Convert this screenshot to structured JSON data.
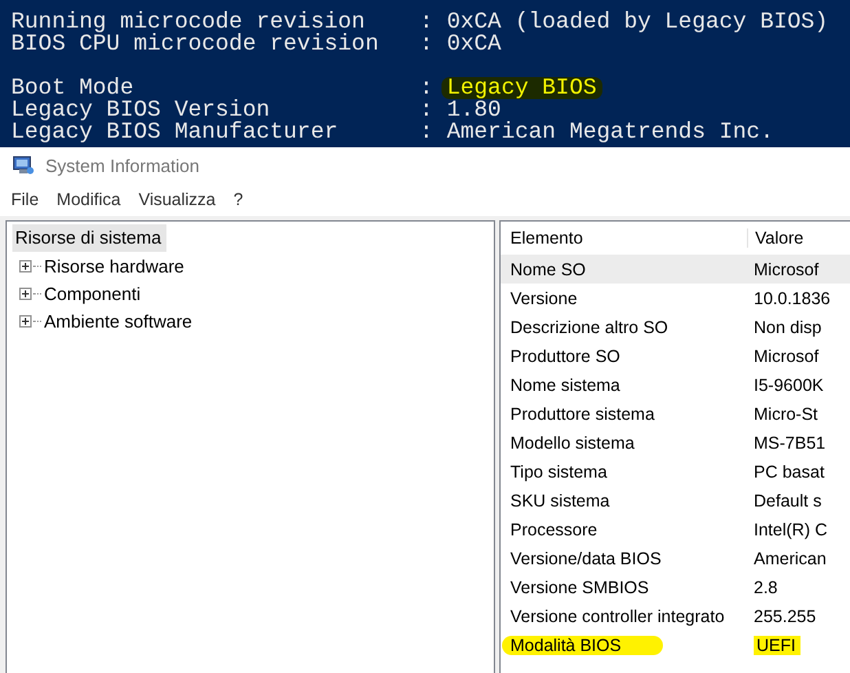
{
  "terminal": {
    "groups": [
      [
        {
          "label": "Running microcode revision",
          "separator": ":",
          "value": "0xCA (loaded by Legacy BIOS)",
          "highlighted": false
        },
        {
          "label": "BIOS CPU microcode revision",
          "separator": ":",
          "value": "0xCA",
          "highlighted": false
        }
      ],
      [
        {
          "label": "Boot Mode",
          "separator": ":",
          "value": "Legacy BIOS",
          "highlighted": true
        },
        {
          "label": "Legacy BIOS Version",
          "separator": ":",
          "value": "1.80",
          "highlighted": false
        },
        {
          "label": "Legacy BIOS Manufacturer",
          "separator": ":",
          "value": "American Megatrends Inc.",
          "highlighted": false
        }
      ]
    ]
  },
  "window": {
    "title": "System Information"
  },
  "menu": [
    "File",
    "Modifica",
    "Visualizza",
    "?"
  ],
  "tree": {
    "label": "Risorse di sistema",
    "selected": true,
    "children": [
      {
        "label": "Risorse hardware",
        "expanded": false,
        "selected": false
      },
      {
        "label": "Componenti",
        "expanded": false,
        "selected": false
      },
      {
        "label": "Ambiente software",
        "expanded": false,
        "selected": false
      }
    ]
  },
  "table": {
    "columns": [
      "Elemento",
      "Valore"
    ],
    "rows": [
      {
        "item": "Nome SO",
        "value": "Microsof",
        "selected": true,
        "highlighted": false
      },
      {
        "item": "Versione",
        "value": "10.0.1836",
        "selected": false,
        "highlighted": false
      },
      {
        "item": "Descrizione altro SO",
        "value": "Non disp",
        "selected": false,
        "highlighted": false
      },
      {
        "item": "Produttore SO",
        "value": "Microsof",
        "selected": false,
        "highlighted": false
      },
      {
        "item": "Nome sistema",
        "value": "I5-9600K",
        "selected": false,
        "highlighted": false
      },
      {
        "item": "Produttore sistema",
        "value": "Micro-St",
        "selected": false,
        "highlighted": false
      },
      {
        "item": "Modello sistema",
        "value": "MS-7B51",
        "selected": false,
        "highlighted": false
      },
      {
        "item": "Tipo sistema",
        "value": "PC basat",
        "selected": false,
        "highlighted": false
      },
      {
        "item": "SKU sistema",
        "value": "Default s",
        "selected": false,
        "highlighted": false
      },
      {
        "item": "Processore",
        "value": "Intel(R) C",
        "selected": false,
        "highlighted": false
      },
      {
        "item": "Versione/data BIOS",
        "value": "American",
        "selected": false,
        "highlighted": false
      },
      {
        "item": "Versione SMBIOS",
        "value": "2.8",
        "selected": false,
        "highlighted": false
      },
      {
        "item": "Versione controller integrato",
        "value": "255.255",
        "selected": false,
        "highlighted": false
      },
      {
        "item": "Modalità BIOS",
        "value": "UEFI",
        "selected": false,
        "highlighted": true
      }
    ]
  }
}
